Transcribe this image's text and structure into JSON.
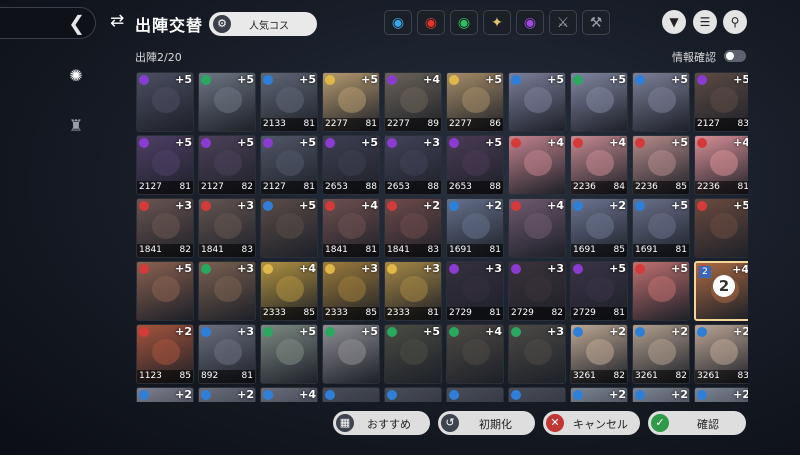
{
  "header": {
    "back_icon": "chevron-left-icon",
    "title": "出陣交替",
    "preset_label": "人気コス",
    "filters": [
      {
        "name": "water-element-icon",
        "glyph": "◉",
        "color": "#3aa7e8"
      },
      {
        "name": "fire-element-icon",
        "glyph": "◉",
        "color": "#e0362c"
      },
      {
        "name": "wind-element-icon",
        "glyph": "◉",
        "color": "#2fbf5f"
      },
      {
        "name": "light-element-icon",
        "glyph": "✦",
        "color": "#e6c36b"
      },
      {
        "name": "dark-element-icon",
        "glyph": "◉",
        "color": "#a04ae0"
      },
      {
        "name": "sword-icon",
        "glyph": "⚔",
        "color": "#9aa0aa"
      },
      {
        "name": "staff-icon",
        "glyph": "⚒",
        "color": "#9aa0aa"
      }
    ],
    "right_buttons": [
      "filter-icon",
      "sort-icon",
      "search-icon"
    ]
  },
  "party": {
    "count_label": "出陣2/20"
  },
  "info_toggle": {
    "label": "情報確認",
    "on": false
  },
  "colors": {
    "water": "#2f7fd8",
    "fire": "#d43a3a",
    "wind": "#2aa860",
    "light": "#e0b84a",
    "dark": "#8a3cd0"
  },
  "rows": [
    {
      "items": [
        {
          "limit": "+5",
          "el": "dark",
          "power": "",
          "level": "",
          "bg": "#4c4f62"
        },
        {
          "limit": "+5",
          "el": "wind",
          "power": "",
          "level": "",
          "bg": "#6d7684"
        },
        {
          "limit": "+5",
          "el": "water",
          "power": "2133",
          "level": "81",
          "bg": "#5f6676"
        },
        {
          "limit": "+5",
          "el": "light",
          "power": "2277",
          "level": "81",
          "bg": "#b4996f"
        },
        {
          "limit": "+4",
          "el": "dark",
          "power": "2277",
          "level": "89",
          "bg": "#6b6258"
        },
        {
          "limit": "+5",
          "el": "light",
          "power": "2277",
          "level": "86",
          "bg": "#a58c67"
        },
        {
          "limit": "+5",
          "el": "water",
          "power": "",
          "level": "",
          "bg": "#7b7f9a"
        },
        {
          "limit": "+5",
          "el": "wind",
          "power": "",
          "level": "",
          "bg": "#8086a0"
        },
        {
          "limit": "+5",
          "el": "water",
          "power": "",
          "level": "",
          "bg": "#7b8098"
        },
        {
          "limit": "+5",
          "el": "dark",
          "power": "2127",
          "level": "83",
          "bg": "#5c4b44"
        }
      ]
    },
    {
      "items": [
        {
          "limit": "+5",
          "el": "dark",
          "power": "2127",
          "level": "81",
          "bg": "#4f3f66"
        },
        {
          "limit": "+5",
          "el": "dark",
          "power": "2127",
          "level": "82",
          "bg": "#4d4159"
        },
        {
          "limit": "+5",
          "el": "dark",
          "power": "2127",
          "level": "81",
          "bg": "#515768"
        },
        {
          "limit": "+5",
          "el": "dark",
          "power": "2653",
          "level": "88",
          "bg": "#3e3f52"
        },
        {
          "limit": "+3",
          "el": "dark",
          "power": "2653",
          "level": "88",
          "bg": "#424358"
        },
        {
          "limit": "+5",
          "el": "dark",
          "power": "2653",
          "level": "88",
          "bg": "#4a3b55"
        },
        {
          "limit": "+4",
          "el": "fire",
          "power": "",
          "level": "",
          "bg": "#c2838d"
        },
        {
          "limit": "+4",
          "el": "fire",
          "power": "2236",
          "level": "84",
          "bg": "#c58990"
        },
        {
          "limit": "+5",
          "el": "fire",
          "power": "2236",
          "level": "85",
          "bg": "#b58b8a"
        },
        {
          "limit": "+4",
          "el": "fire",
          "power": "2236",
          "level": "81",
          "bg": "#d78f96"
        }
      ]
    },
    {
      "items": [
        {
          "limit": "+3",
          "el": "fire",
          "power": "1841",
          "level": "82",
          "bg": "#6a5551"
        },
        {
          "limit": "+3",
          "el": "fire",
          "power": "1841",
          "level": "83",
          "bg": "#645551"
        },
        {
          "limit": "+5",
          "el": "water",
          "power": "",
          "level": "",
          "bg": "#5a4d48"
        },
        {
          "limit": "+4",
          "el": "fire",
          "power": "1841",
          "level": "81",
          "bg": "#6f5050"
        },
        {
          "limit": "+2",
          "el": "fire",
          "power": "1841",
          "level": "83",
          "bg": "#6e4b4b"
        },
        {
          "limit": "+2",
          "el": "water",
          "power": "1691",
          "level": "81",
          "bg": "#65708a"
        },
        {
          "limit": "+4",
          "el": "fire",
          "power": "",
          "level": "",
          "bg": "#6f5a6f"
        },
        {
          "limit": "+2",
          "el": "water",
          "power": "1691",
          "level": "85",
          "bg": "#6c7590"
        },
        {
          "limit": "+5",
          "el": "water",
          "power": "1691",
          "level": "81",
          "bg": "#687089"
        },
        {
          "limit": "+5",
          "el": "fire",
          "power": "",
          "level": "",
          "bg": "#6a4b3f"
        }
      ]
    },
    {
      "items": [
        {
          "limit": "+5",
          "el": "fire",
          "power": "",
          "level": "",
          "bg": "#8a6150"
        },
        {
          "limit": "+3",
          "el": "wind",
          "power": "",
          "level": "",
          "bg": "#7a6050"
        },
        {
          "limit": "+4",
          "el": "light",
          "power": "2333",
          "level": "85",
          "bg": "#b0913f"
        },
        {
          "limit": "+3",
          "el": "light",
          "power": "2333",
          "level": "85",
          "bg": "#9c7b3b"
        },
        {
          "limit": "+3",
          "el": "light",
          "power": "2333",
          "level": "81",
          "bg": "#a58745"
        },
        {
          "limit": "+3",
          "el": "dark",
          "power": "2729",
          "level": "81",
          "bg": "#35303e"
        },
        {
          "limit": "+3",
          "el": "dark",
          "power": "2729",
          "level": "82",
          "bg": "#3b323b"
        },
        {
          "limit": "+5",
          "el": "dark",
          "power": "2729",
          "level": "81",
          "bg": "#3a3347"
        },
        {
          "limit": "+5",
          "el": "fire",
          "power": "",
          "level": "",
          "bg": "#c07070"
        },
        {
          "limit": "+4",
          "el": "fire",
          "power": "",
          "level": "",
          "bg": "#a96a43",
          "selected": true,
          "slot": "2",
          "badge": "2"
        }
      ]
    },
    {
      "items": [
        {
          "limit": "+2",
          "el": "fire",
          "power": "1123",
          "level": "85",
          "bg": "#a5543c"
        },
        {
          "limit": "+3",
          "el": "water",
          "power": "892",
          "level": "81",
          "bg": "#6b7080"
        },
        {
          "limit": "+5",
          "el": "wind",
          "power": "",
          "level": "",
          "bg": "#7d8a84"
        },
        {
          "limit": "+5",
          "el": "wind",
          "power": "",
          "level": "",
          "bg": "#8f8e95"
        },
        {
          "limit": "+5",
          "el": "wind",
          "power": "",
          "level": "",
          "bg": "#4a4c43"
        },
        {
          "limit": "+4",
          "el": "wind",
          "power": "",
          "level": "",
          "bg": "#4e4a45"
        },
        {
          "limit": "+3",
          "el": "wind",
          "power": "",
          "level": "",
          "bg": "#4c4a46"
        },
        {
          "limit": "+2",
          "el": "water",
          "power": "3261",
          "level": "82",
          "bg": "#bda793"
        },
        {
          "limit": "+2",
          "el": "water",
          "power": "3261",
          "level": "82",
          "bg": "#b19e8e"
        },
        {
          "limit": "+2",
          "el": "water",
          "power": "3261",
          "level": "83",
          "bg": "#bba595"
        }
      ]
    },
    {
      "items": [
        {
          "limit": "+2",
          "el": "water",
          "power": "",
          "level": "",
          "bg": "#7d7f8f"
        },
        {
          "limit": "+2",
          "el": "water",
          "power": "",
          "level": "",
          "bg": "#6a6e7c"
        },
        {
          "limit": "+4",
          "el": "water",
          "power": "",
          "level": "",
          "bg": "#6a6e7c"
        },
        {
          "limit": "",
          "el": "water",
          "power": "",
          "level": "",
          "bg": "#4a4e5a"
        },
        {
          "limit": "",
          "el": "water",
          "power": "",
          "level": "",
          "bg": "#4a4e5a"
        },
        {
          "limit": "",
          "el": "water",
          "power": "",
          "level": "",
          "bg": "#4a4e5a"
        },
        {
          "limit": "",
          "el": "water",
          "power": "",
          "level": "",
          "bg": "#4a4e5a"
        },
        {
          "limit": "+2",
          "el": "water",
          "power": "",
          "level": "",
          "bg": "#7d8594"
        },
        {
          "limit": "+2",
          "el": "water",
          "power": "",
          "level": "",
          "bg": "#7d8594"
        },
        {
          "limit": "+2",
          "el": "water",
          "power": "",
          "level": "",
          "bg": "#7d8594"
        }
      ]
    }
  ],
  "footer": {
    "recommend_label": "おすすめ",
    "reset_label": "初期化",
    "cancel_label": "キャンセル",
    "confirm_label": "確認"
  }
}
